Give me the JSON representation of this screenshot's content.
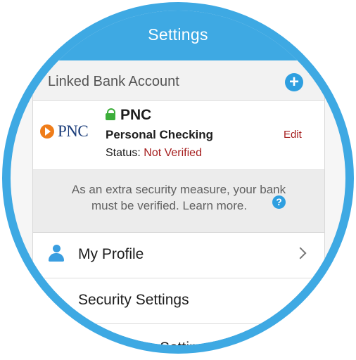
{
  "header": {
    "title": "Settings"
  },
  "linked_bank": {
    "section_title": "Linked Bank Account",
    "bank_logo_text": "PNC",
    "bank_name": "PNC",
    "account_type": "Personal Checking",
    "status_label": "Status:",
    "status_value": "Not Verified",
    "edit_label": "Edit",
    "notice_line1": "As an extra security measure, your bank",
    "notice_line2": "must be verified. Learn more.",
    "help_glyph": "?"
  },
  "menu": {
    "profile_label": "My Profile",
    "security_label": "Security Settings",
    "partial_label": "Settings"
  },
  "icons": {
    "add": "plus-circle-icon",
    "lock": "lock-icon",
    "help": "question-circle-icon",
    "profile": "person-icon",
    "chevron": "chevron-right-icon"
  },
  "colors": {
    "brand_blue": "#3ea9e3",
    "accent_blue": "#2e9fe0",
    "status_red": "#a51d1d",
    "lock_green": "#3cae3a",
    "pnc_orange": "#ef7d1a",
    "pnc_navy": "#1b3d7a"
  }
}
